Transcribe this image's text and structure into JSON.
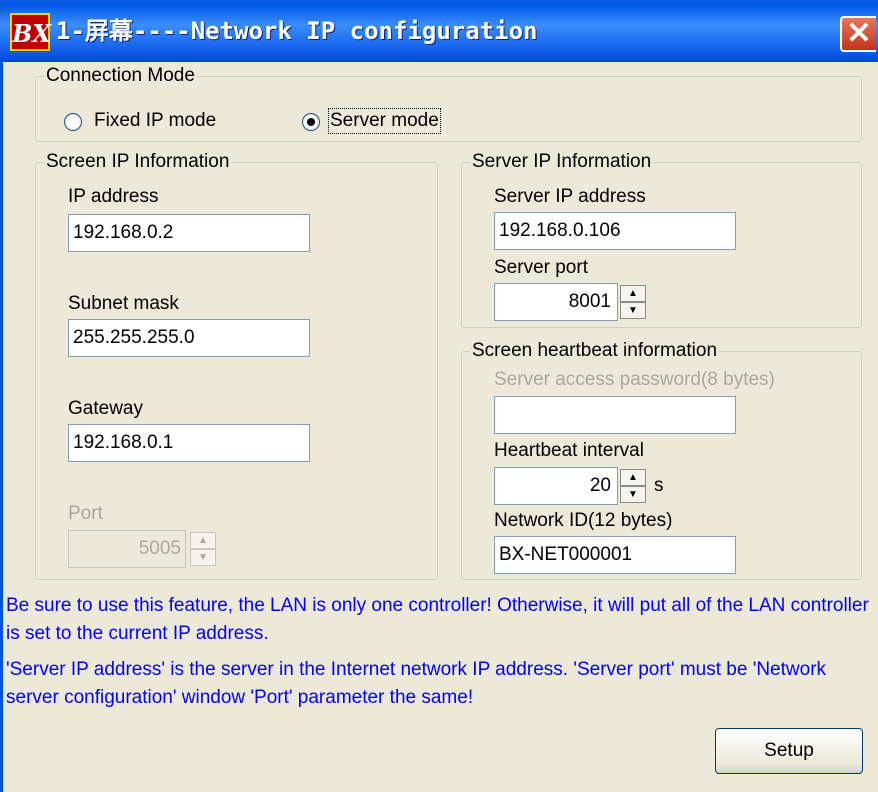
{
  "window": {
    "icon_text": "BX",
    "title": "1-屏幕----Network IP configuration",
    "close_glyph": "✕"
  },
  "connection_mode": {
    "legend": "Connection Mode",
    "options": [
      {
        "label": "Fixed IP mode",
        "checked": false
      },
      {
        "label": "Server mode",
        "checked": true
      }
    ]
  },
  "screen_ip": {
    "legend": "Screen IP Information",
    "ip_label": "IP address",
    "ip_value": "192.168.0.2",
    "subnet_label": "Subnet mask",
    "subnet_value": "255.255.255.0",
    "gateway_label": "Gateway",
    "gateway_value": "192.168.0.1",
    "port_label": "Port",
    "port_value": "5005"
  },
  "server_ip": {
    "legend": "Server IP Information",
    "ip_label": "Server IP address",
    "ip_value": "192.168.0.106",
    "port_label": "Server port",
    "port_value": "8001"
  },
  "heartbeat": {
    "legend": "Screen heartbeat information",
    "password_label": "Server access password(8 bytes)",
    "password_value": "",
    "interval_label": "Heartbeat interval",
    "interval_value": "20",
    "interval_unit": "s",
    "network_id_label": "Network ID(12 bytes)",
    "network_id_value": "BX-NET000001"
  },
  "notes": [
    "Be sure to use this feature, the LAN is only one controller! Otherwise, it will put all of the LAN controller is set to the current IP address.",
    "'Server IP address' is the server in the Internet network IP address. 'Server port' must be 'Network server configuration' window 'Port' parameter the same!"
  ],
  "buttons": {
    "setup": "Setup"
  },
  "icons": {
    "spin_up": "▲",
    "spin_down": "▼"
  }
}
